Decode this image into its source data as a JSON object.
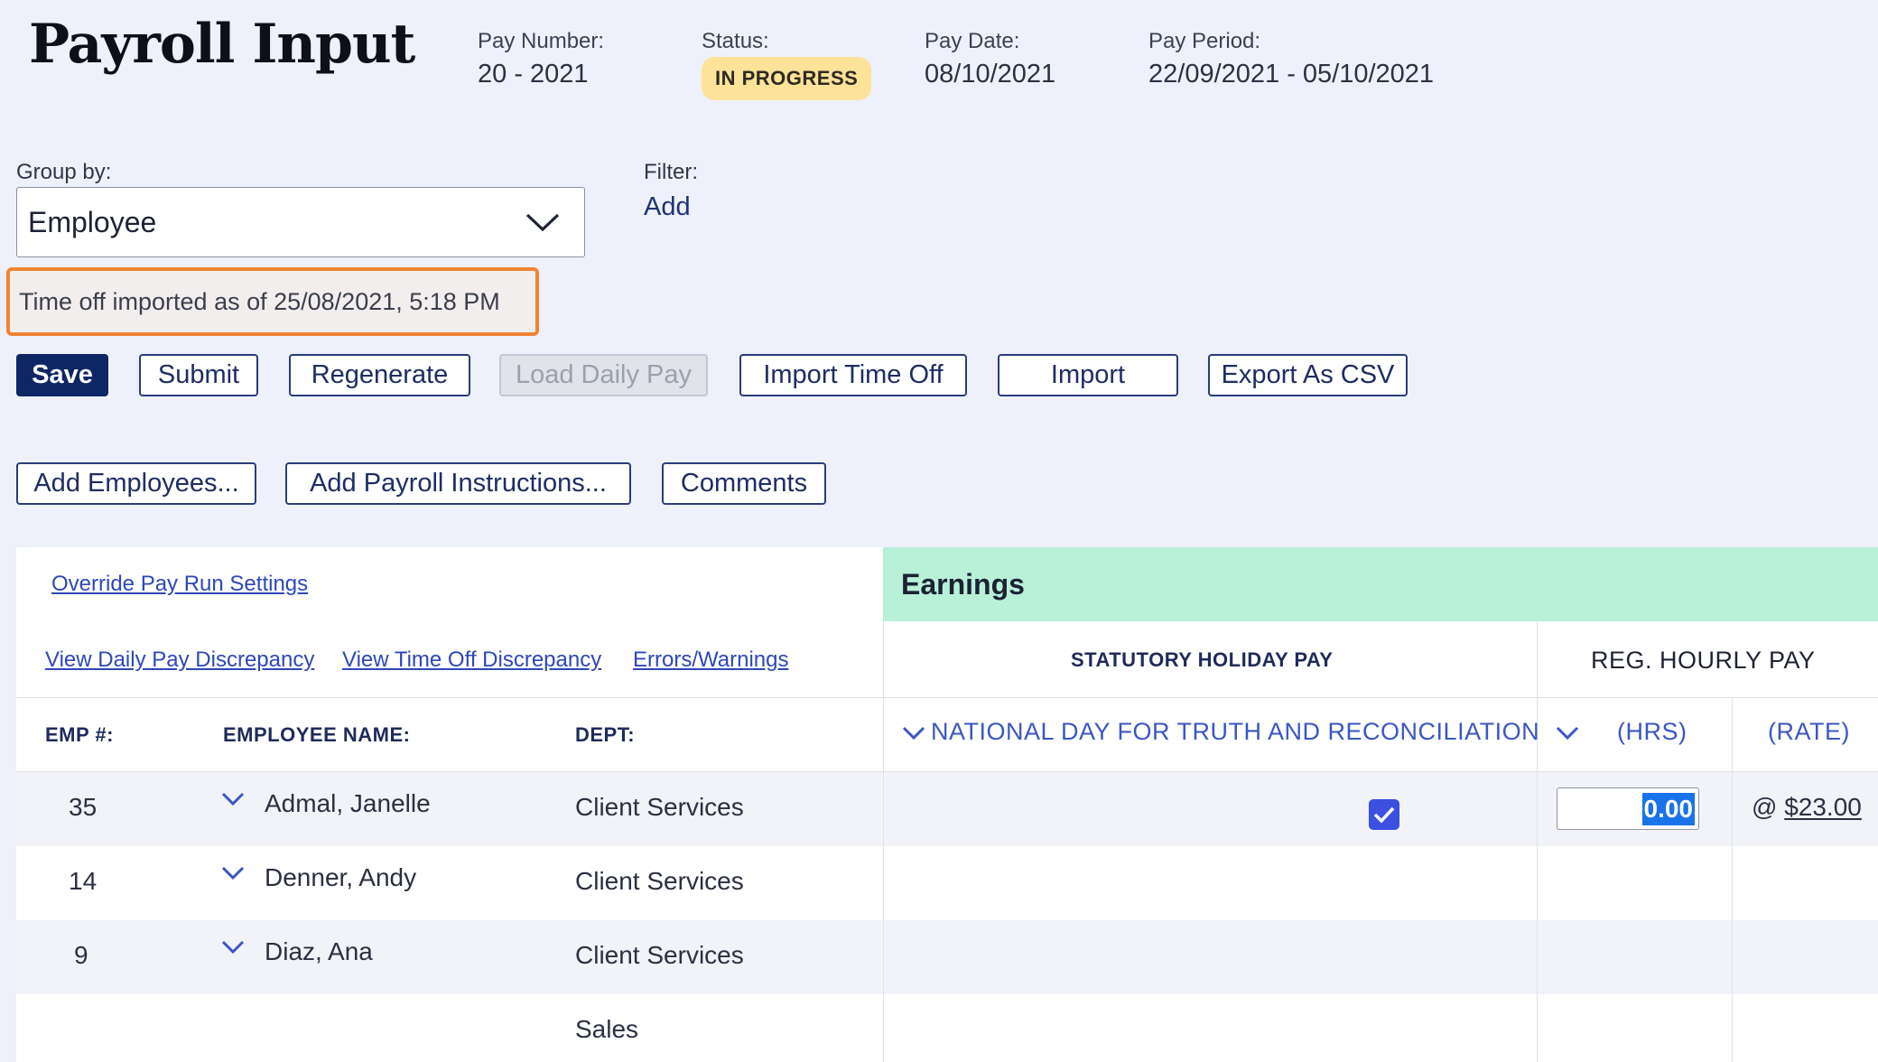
{
  "header": {
    "title": "Payroll Input",
    "pay_number_label": "Pay Number:",
    "pay_number": "20 - 2021",
    "status_label": "Status:",
    "status": "IN PROGRESS",
    "pay_date_label": "Pay Date:",
    "pay_date": "08/10/2021",
    "pay_period_label": "Pay Period:",
    "pay_period": "22/09/2021 - 05/10/2021"
  },
  "controls": {
    "group_by_label": "Group by:",
    "group_by_value": "Employee",
    "filter_label": "Filter:",
    "filter_add": "Add",
    "import_notice": "Time off imported as of 25/08/2021, 5:18 PM"
  },
  "toolbar": {
    "save": "Save",
    "submit": "Submit",
    "regenerate": "Regenerate",
    "load_daily_pay": "Load Daily Pay",
    "import_time_off": "Import Time Off",
    "import": "Import",
    "export_csv": "Export As CSV",
    "add_employees": "Add Employees...",
    "add_instructions": "Add Payroll Instructions...",
    "comments": "Comments"
  },
  "table": {
    "links": {
      "override": "Override Pay Run Settings",
      "daily_pay_discrepancy": "View Daily Pay Discrepancy",
      "time_off_discrepancy": "View Time Off Discrepancy",
      "errors_warnings": "Errors/Warnings"
    },
    "columns": {
      "emp": "EMP #:",
      "name": "EMPLOYEE NAME:",
      "dept": "DEPT:"
    },
    "earnings": {
      "title": "Earnings",
      "stat_holiday": "STATUTORY HOLIDAY PAY",
      "stat_holiday_sub": "NATIONAL DAY FOR TRUTH AND RECONCILIATION",
      "reg_hourly": "REG. HOURLY PAY",
      "hrs": "(HRS)",
      "rate": "(RATE)"
    },
    "rows": [
      {
        "emp": "35",
        "name": "Admal, Janelle",
        "dept": "Client Services",
        "hrs": "0.00",
        "at": "@",
        "rate": "$23.00",
        "stat_checked": true
      },
      {
        "emp": "14",
        "name": "Denner, Andy",
        "dept": "Client Services"
      },
      {
        "emp": "9",
        "name": "Diaz, Ana",
        "dept": "Client Services"
      },
      {
        "emp": "",
        "name": "",
        "dept": "Sales"
      }
    ]
  },
  "colors": {
    "primary": "#0f2665",
    "status_badge": "#fde29a",
    "earnings_header": "#b8f0d8",
    "highlight_border": "#f08434",
    "link": "#2f47b8"
  }
}
